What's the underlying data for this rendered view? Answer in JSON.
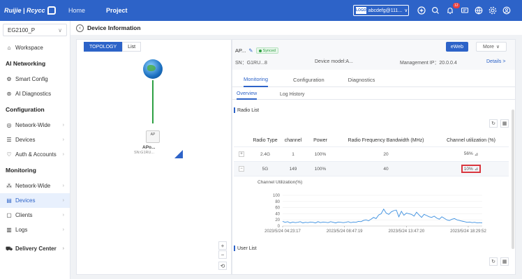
{
  "topbar": {
    "brand": "Ruijie | Rcycc",
    "nav": {
      "home": "Home",
      "project": "Project"
    },
    "account": {
      "logo_text": "LOGO",
      "name": "abcdefg@111..."
    },
    "notification_count": "12"
  },
  "sidebar": {
    "site": "EG2100_P",
    "workspace": "Workspace",
    "groups": {
      "ai_networking": "AI Networking",
      "configuration": "Configuration",
      "monitoring": "Monitoring"
    },
    "items": {
      "smart_config": "Smart Config",
      "ai_diagnostics": "AI Diagnostics",
      "network_wide_cfg": "Network-Wide",
      "devices_cfg": "Devices",
      "auth_accounts": "Auth & Accounts",
      "network_wide_mon": "Network-Wide",
      "devices_mon": "Devices",
      "clients": "Clients",
      "logs": "Logs",
      "delivery_center": "Delivery Center"
    }
  },
  "breadcrumb": {
    "title": "Device Information"
  },
  "topology": {
    "tabs": {
      "topology": "TOPOLOGY",
      "list": "List"
    },
    "ap_icon_label": "AP",
    "ap_name": "APo...",
    "ap_sn": "SN:G1RU...",
    "zoom_in": "+",
    "zoom_out": "−"
  },
  "device": {
    "name": "AP...",
    "status": "Synced",
    "sn": "SN：G1RU...8",
    "model": "Device model:A...",
    "mgmt_ip": "Management IP：20.0.0.4",
    "details_link": "Details >",
    "eweb_button": "eWeb",
    "more_button": "More"
  },
  "tabs": {
    "monitoring": "Monitoring",
    "configuration": "Configuration",
    "diagnostics": "Diagnostics",
    "overview": "Overview",
    "log_history": "Log History"
  },
  "radio_list": {
    "title": "Radio List",
    "headers": [
      "Radio Type",
      "channel",
      "Power",
      "Radio Frequency Bandwidth (MHz)",
      "Channel utilization (%)"
    ],
    "rows": [
      {
        "expander": "+",
        "type": "2.4G",
        "channel": "1",
        "power": "100%",
        "bandwidth": "20",
        "utilization": "56%"
      },
      {
        "expander": "−",
        "type": "5G",
        "channel": "149",
        "power": "100%",
        "bandwidth": "40",
        "utilization": "10%"
      }
    ]
  },
  "user_list": {
    "title": "User List"
  },
  "colors": {
    "accent": "#2d63c8",
    "success": "#2ea043",
    "highlight": "#d9363e"
  },
  "chart_data": {
    "type": "line",
    "title": "Channel Utilization(%)",
    "xlabel": "",
    "ylabel": "",
    "ylim": [
      0,
      100
    ],
    "yticks": [
      0,
      20,
      40,
      60,
      80,
      100
    ],
    "xtick_labels": [
      "2023/5/24 04:23:17",
      "2023/5/24 08:47:19",
      "2023/5/24 13:47:20",
      "2023/5/24 18:29:52"
    ],
    "series": [
      {
        "color": "#3b8fe0",
        "values": [
          15,
          12,
          14,
          10,
          13,
          11,
          12,
          14,
          10,
          12,
          11,
          13,
          12,
          10,
          14,
          11,
          13,
          12,
          11,
          14,
          12,
          10,
          13,
          12,
          11,
          12,
          14,
          11,
          13,
          12,
          15,
          14,
          18,
          20,
          17,
          22,
          28,
          24,
          36,
          40,
          55,
          42,
          38,
          46,
          50,
          52,
          30,
          48,
          35,
          42,
          40,
          38,
          32,
          45,
          36,
          28,
          38,
          34,
          30,
          28,
          32,
          26,
          22,
          30,
          25,
          20,
          18,
          22,
          24,
          20,
          18,
          16,
          14,
          12,
          13,
          11,
          12,
          10,
          11,
          10
        ]
      }
    ]
  }
}
